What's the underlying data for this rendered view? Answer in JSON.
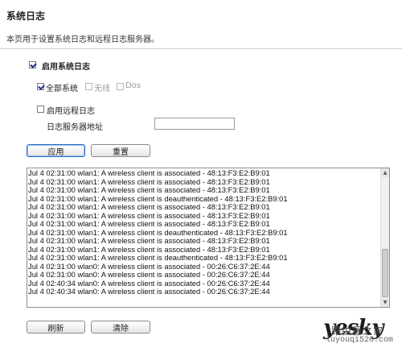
{
  "page": {
    "title": "系统日志",
    "description": "本页用于设置系统日志和远程日志服务器。"
  },
  "settings": {
    "enable_syslog": {
      "label": "启用系统日志",
      "checked": true
    },
    "filters": [
      {
        "label": "全部系统",
        "checked": true,
        "enabled": true
      },
      {
        "label": "无线",
        "checked": false,
        "enabled": false
      },
      {
        "label": "Dos",
        "checked": false,
        "enabled": false
      }
    ],
    "enable_remote": {
      "label": "启用远程日志",
      "checked": false
    },
    "server_address": {
      "label": "日志服务器地址",
      "value": ""
    }
  },
  "buttons": {
    "apply": "应用",
    "reset": "重置",
    "refresh": "刷新",
    "clear": "清除"
  },
  "log_lines": [
    "Jul  4 02:31:00 wlan1: A wireless client is associated - 48:13:F3:E2:B9:01",
    "Jul  4 02:31:00 wlan1: A wireless client is associated - 48:13:F3:E2:B9:01",
    "Jul  4 02:31:00 wlan1: A wireless client is associated - 48:13:F3:E2:B9:01",
    "Jul  4 02:31:00 wlan1: A wireless client is deauthenticated - 48:13:F3:E2:B9:01",
    "Jul  4 02:31:00 wlan1: A wireless client is associated - 48:13:F3:E2:B9:01",
    "Jul  4 02:31:00 wlan1: A wireless client is associated - 48:13:F3:E2:B9:01",
    "Jul  4 02:31:00 wlan1: A wireless client is associated - 48:13:F3:E2:B9:01",
    "Jul  4 02:31:00 wlan1: A wireless client is deauthenticated - 48:13:F3:E2:B9:01",
    "Jul  4 02:31:00 wlan1: A wireless client is associated - 48:13:F3:E2:B9:01",
    "Jul  4 02:31:00 wlan1: A wireless client is associated - 48:13:F3:E2:B9:01",
    "Jul  4 02:31:00 wlan1: A wireless client is deauthenticated - 48:13:F3:E2:B9:01",
    "Jul  4 02:31:00 wlan0: A wireless client is associated - 00:26:C6:37:2E:44",
    "Jul  4 02:31:00 wlan0: A wireless client is associated - 00:26:C6:37:2E:44",
    "Jul  4 02:40:34 wlan0: A wireless client is associated - 00:26:C6:37:2E:44",
    "Jul  4 02:40:34 wlan0: A wireless client is associated - 00:26:C6:37:2E:44"
  ],
  "watermark": {
    "logo": "yesky",
    "text": "路由器之家",
    "url": "luyouqi520.com"
  }
}
